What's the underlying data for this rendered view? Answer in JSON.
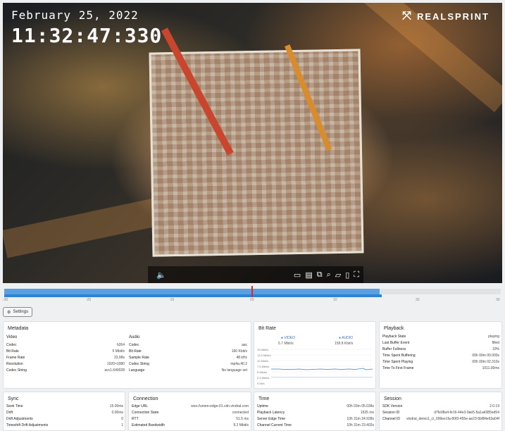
{
  "overlay": {
    "date": "February 25, 2022",
    "time": "11:32:47:330",
    "brand": "REALSPRINT"
  },
  "timeline": {
    "ticks": [
      "-30",
      "-25",
      "-15",
      "00",
      "10",
      "20",
      "30"
    ],
    "buffered_fraction": 0.755,
    "playhead_fraction": 0.5
  },
  "settings_label": "Settings",
  "metadata": {
    "title": "Metadata",
    "video_head": "Video",
    "audio_head": "Audio",
    "video": [
      {
        "k": "Codec",
        "v": "h264"
      },
      {
        "k": "Bit Rate",
        "v": "5 Mbit/s"
      },
      {
        "k": "Frame Rate",
        "v": "23.98s"
      },
      {
        "k": "Resolution",
        "v": "1920×1080"
      },
      {
        "k": "Codec String",
        "v": "avc1.640028"
      }
    ],
    "audio": [
      {
        "k": "Codec",
        "v": "aac"
      },
      {
        "k": "Bit Rate",
        "v": "160 Kbit/s"
      },
      {
        "k": "Sample Rate",
        "v": "48 kHz"
      },
      {
        "k": "Codec String",
        "v": "mp4a.40.2"
      },
      {
        "k": "Language",
        "v": "No language set"
      }
    ]
  },
  "bitrate": {
    "title": "Bit Rate",
    "video_label": "VIDEO",
    "audio_label": "AUDIO",
    "video_value": "5.7 Mbit/s",
    "audio_value": "158.8 Kbit/s",
    "yticks": [
      "15 Mbit/s",
      "12.5 Mbit/s",
      "10 Mbit/s",
      "7.5 Mbit/s",
      "5 Mbit/s",
      "2.5 Mbit/s",
      "0 bit/s"
    ]
  },
  "playback": {
    "title": "Playback",
    "rows": [
      {
        "k": "Playback State",
        "v": "playing"
      },
      {
        "k": "Last Buffer Event",
        "v": "filled"
      },
      {
        "k": "Buffer Fullness",
        "v": "10%"
      },
      {
        "k": "Time Spent Buffering",
        "v": "00h 00m 00.000s"
      },
      {
        "k": "Time Spent Playing",
        "v": "00h 00m 02.310s"
      },
      {
        "k": "Time To First Frame",
        "v": "1011.00ms"
      }
    ]
  },
  "sync": {
    "title": "Sync",
    "rows": [
      {
        "k": "Seek Time",
        "v": "15.00ms"
      },
      {
        "k": "Drift",
        "v": "0.00ms"
      },
      {
        "k": "Drift Adjustments",
        "v": "0"
      },
      {
        "k": "Timeshift Drift Adjustments",
        "v": "1"
      }
    ]
  },
  "connection": {
    "title": "Connection",
    "rows": [
      {
        "k": "Edge URL",
        "v": "wss://umen-edge-01.cdn.vindral.com"
      },
      {
        "k": "Connection State",
        "v": "connected"
      },
      {
        "k": "RTT",
        "v": "51.5 ms"
      },
      {
        "k": "Estimated Bandwidth",
        "v": "9.2 Mbit/s"
      }
    ]
  },
  "time": {
    "title": "Time",
    "rows": [
      {
        "k": "Uptime",
        "v": "00h 03m 05.034s"
      },
      {
        "k": "Playback Latency",
        "v": "1525 ms"
      },
      {
        "k": "Server Edge Time",
        "v": "10h 31m 24.928s"
      },
      {
        "k": "Channel Current Time",
        "v": "10h 31m 23.402s"
      }
    ]
  },
  "session": {
    "title": "Session",
    "rows": [
      {
        "k": "SDK Version",
        "v": "2.0.19"
      },
      {
        "k": "Session ID",
        "v": "d7fe08a4-fe16-44e3-9ae5-5a1a4385ed54"
      },
      {
        "k": "Channel ID",
        "v": "vindral_demo1_ci_099ee1fa-80f3-455e-ae23-5bf84e63a04f"
      }
    ]
  },
  "colors": {
    "accent": "#2f83d6",
    "playhead": "#d9272e"
  }
}
